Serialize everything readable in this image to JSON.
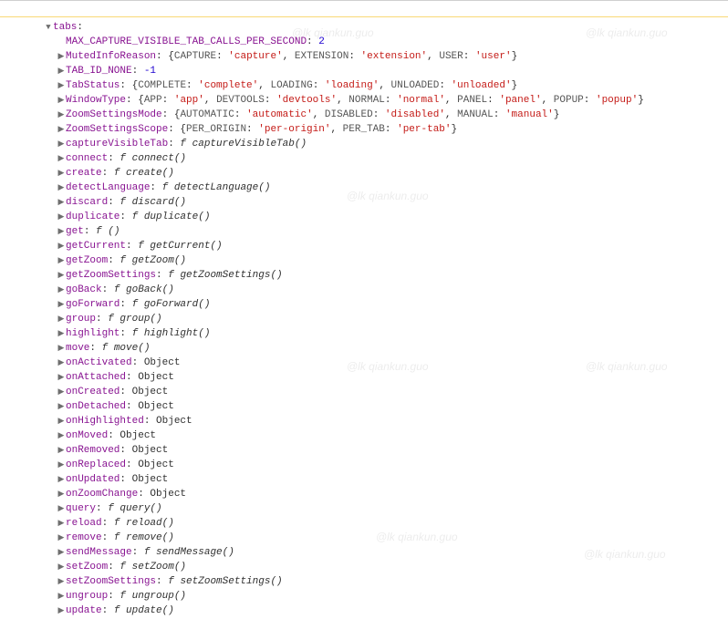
{
  "top_row": {
    "key": "tabs",
    "open": true
  },
  "indent_row": {
    "key": "MAX_CAPTURE_VISIBLE_TAB_CALLS_PER_SECOND",
    "value_num": "2"
  },
  "rows": [
    {
      "type": "enum",
      "key": "MutedInfoReason",
      "pairs": [
        {
          "k": "CAPTURE",
          "v": "'capture'"
        },
        {
          "k": "EXTENSION",
          "v": "'extension'"
        },
        {
          "k": "USER",
          "v": "'user'"
        }
      ]
    },
    {
      "type": "num",
      "key": "TAB_ID_NONE",
      "value": "-1"
    },
    {
      "type": "enum",
      "key": "TabStatus",
      "pairs": [
        {
          "k": "COMPLETE",
          "v": "'complete'"
        },
        {
          "k": "LOADING",
          "v": "'loading'"
        },
        {
          "k": "UNLOADED",
          "v": "'unloaded'"
        }
      ]
    },
    {
      "type": "enum",
      "key": "WindowType",
      "pairs": [
        {
          "k": "APP",
          "v": "'app'"
        },
        {
          "k": "DEVTOOLS",
          "v": "'devtools'"
        },
        {
          "k": "NORMAL",
          "v": "'normal'"
        },
        {
          "k": "PANEL",
          "v": "'panel'"
        },
        {
          "k": "POPUP",
          "v": "'popup'"
        }
      ]
    },
    {
      "type": "enum",
      "key": "ZoomSettingsMode",
      "pairs": [
        {
          "k": "AUTOMATIC",
          "v": "'automatic'"
        },
        {
          "k": "DISABLED",
          "v": "'disabled'"
        },
        {
          "k": "MANUAL",
          "v": "'manual'"
        }
      ]
    },
    {
      "type": "enum",
      "key": "ZoomSettingsScope",
      "pairs": [
        {
          "k": "PER_ORIGIN",
          "v": "'per-origin'"
        },
        {
          "k": "PER_TAB",
          "v": "'per-tab'"
        }
      ]
    },
    {
      "type": "fn",
      "key": "captureVisibleTab",
      "fn": "captureVisibleTab()"
    },
    {
      "type": "fn",
      "key": "connect",
      "fn": "connect()"
    },
    {
      "type": "fn",
      "key": "create",
      "fn": "create()"
    },
    {
      "type": "fn",
      "key": "detectLanguage",
      "fn": "detectLanguage()"
    },
    {
      "type": "fn",
      "key": "discard",
      "fn": "discard()"
    },
    {
      "type": "fn",
      "key": "duplicate",
      "fn": "duplicate()"
    },
    {
      "type": "fn",
      "key": "get",
      "fn": "()"
    },
    {
      "type": "fn",
      "key": "getCurrent",
      "fn": "getCurrent()"
    },
    {
      "type": "fn",
      "key": "getZoom",
      "fn": "getZoom()"
    },
    {
      "type": "fn",
      "key": "getZoomSettings",
      "fn": "getZoomSettings()"
    },
    {
      "type": "fn",
      "key": "goBack",
      "fn": "goBack()"
    },
    {
      "type": "fn",
      "key": "goForward",
      "fn": "goForward()"
    },
    {
      "type": "fn",
      "key": "group",
      "fn": "group()"
    },
    {
      "type": "fn",
      "key": "highlight",
      "fn": "highlight()"
    },
    {
      "type": "fn",
      "key": "move",
      "fn": "move()"
    },
    {
      "type": "obj",
      "key": "onActivated"
    },
    {
      "type": "obj",
      "key": "onAttached"
    },
    {
      "type": "obj",
      "key": "onCreated"
    },
    {
      "type": "obj",
      "key": "onDetached"
    },
    {
      "type": "obj",
      "key": "onHighlighted"
    },
    {
      "type": "obj",
      "key": "onMoved"
    },
    {
      "type": "obj",
      "key": "onRemoved"
    },
    {
      "type": "obj",
      "key": "onReplaced"
    },
    {
      "type": "obj",
      "key": "onUpdated"
    },
    {
      "type": "obj",
      "key": "onZoomChange"
    },
    {
      "type": "fn",
      "key": "query",
      "fn": "query()"
    },
    {
      "type": "fn",
      "key": "reload",
      "fn": "reload()"
    },
    {
      "type": "fn",
      "key": "remove",
      "fn": "remove()"
    },
    {
      "type": "fn",
      "key": "sendMessage",
      "fn": "sendMessage()"
    },
    {
      "type": "fn",
      "key": "setZoom",
      "fn": "setZoom()"
    },
    {
      "type": "fn",
      "key": "setZoomSettings",
      "fn": "setZoomSettings()"
    },
    {
      "type": "fn",
      "key": "ungroup",
      "fn": "ungroup()"
    },
    {
      "type": "fn",
      "key": "update",
      "fn": "update()"
    }
  ],
  "watermark": "@lk qiankun.guo",
  "tokens": {
    "f": "f ",
    "Object": "Object"
  }
}
